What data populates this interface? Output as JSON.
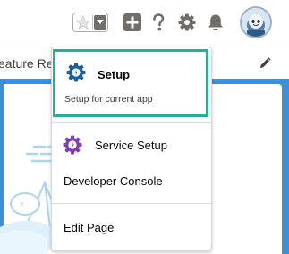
{
  "header": {
    "favorites_icon": "star-icon",
    "favorites_menu_icon": "chevron-down-icon",
    "global_actions_icon": "plus-icon",
    "help_icon": "question-icon",
    "setup_icon": "gear-icon",
    "notifications_icon": "bell-icon",
    "avatar_icon": "astro-avatar-icon"
  },
  "page": {
    "title_fragment": "eature Re",
    "edit_icon": "pencil-icon"
  },
  "setup_menu": {
    "items": [
      {
        "label": "Setup",
        "sublabel": "Setup for current app",
        "icon": "gear-icon",
        "selected": true
      },
      {
        "label": "Service Setup",
        "icon": "gear-icon"
      },
      {
        "label": "Developer Console"
      },
      {
        "label": "Edit Page"
      }
    ]
  },
  "colors": {
    "accent_teal": "#2bac97",
    "setup_gear": "#1b5f9e",
    "service_gear": "#7f3fb6",
    "page_blue": "#3c8fd9"
  }
}
